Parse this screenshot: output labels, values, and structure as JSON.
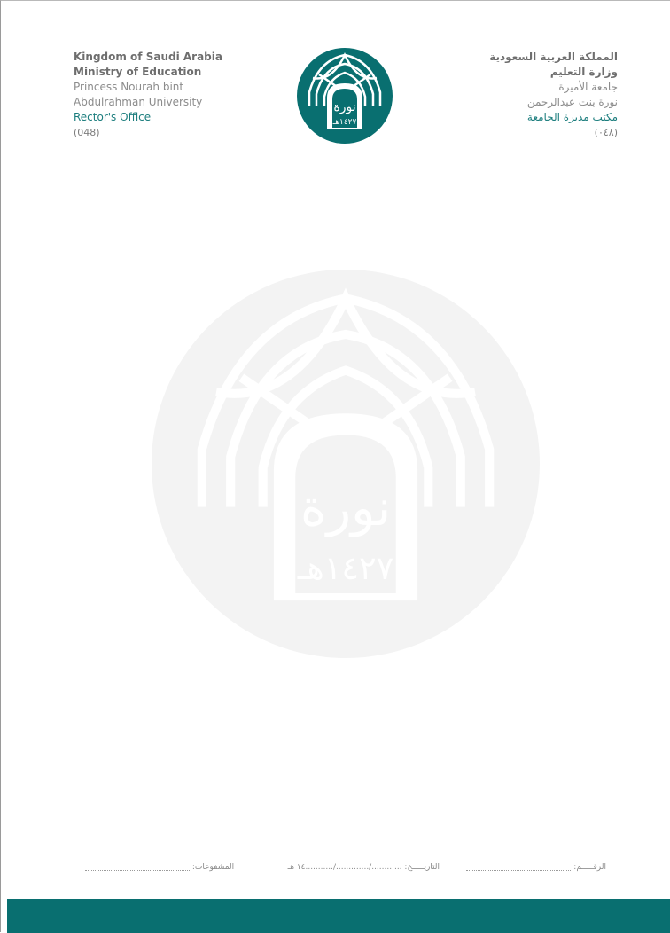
{
  "header": {
    "en": {
      "kingdom": "Kingdom of Saudi Arabia",
      "ministry": "Ministry of Education",
      "university_line1": "Princess Nourah bint",
      "university_line2": "Abdulrahman University",
      "office": "Rector's Office",
      "phone_code": "(048)"
    },
    "ar": {
      "kingdom": "المملكة العربية السعودية",
      "ministry": "وزارة التعليم",
      "university_line1": "جامعة الأميرة",
      "university_line2": "نورة بنت عبدالرحمن",
      "office": "مكتب مديرة الجامعة",
      "phone_code": "(٠٤٨)"
    }
  },
  "logo": {
    "calligraphy": "نورة",
    "year": "١٤٢٧هـ",
    "brand_color": "#096f70"
  },
  "footer": {
    "number_label": "الرقـــــم:",
    "date_label": "التاريـــــخ:",
    "date_pattern": "............/............./...........١٤ هـ",
    "attachments_label": "المشفوعات:",
    "bar_color": "#096f70"
  }
}
